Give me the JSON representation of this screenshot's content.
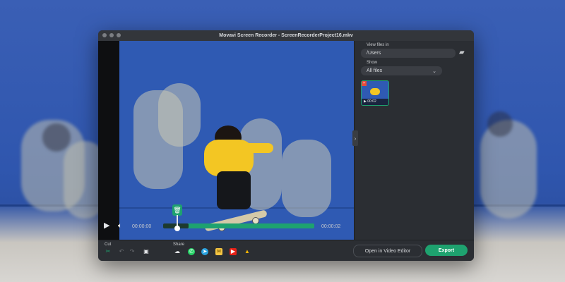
{
  "window": {
    "title": "Movavi Screen Recorder - ScreenRecorderProject16.mkv"
  },
  "panel": {
    "view_files_label": "View files in",
    "path_value": "/Users",
    "show_label": "Show",
    "filter_value": "All files",
    "thumbnail_duration": "00:02"
  },
  "player": {
    "current_time": "00:00:00",
    "total_time": "00:00:02"
  },
  "bottom": {
    "cut_label": "Cut",
    "share_label": "Share",
    "open_editor_label": "Open in Video Editor",
    "export_label": "Export"
  },
  "icons": {
    "play": "play-icon",
    "volume": "volume-icon",
    "cut": "scissors-icon",
    "undo": "undo-icon",
    "redo": "redo-icon",
    "snapshot": "camera-icon",
    "delete": "trash-icon",
    "folder": "folder-icon",
    "share_cloud": "cloud-upload-icon",
    "whatsapp": "whatsapp-icon",
    "telegram": "telegram-icon",
    "email": "mail-icon",
    "youtube": "youtube-icon",
    "drive": "google-drive-icon"
  },
  "colors": {
    "accent": "#1ea26f",
    "window_bg": "#2b2e33",
    "field_bg": "#3b3e44"
  }
}
